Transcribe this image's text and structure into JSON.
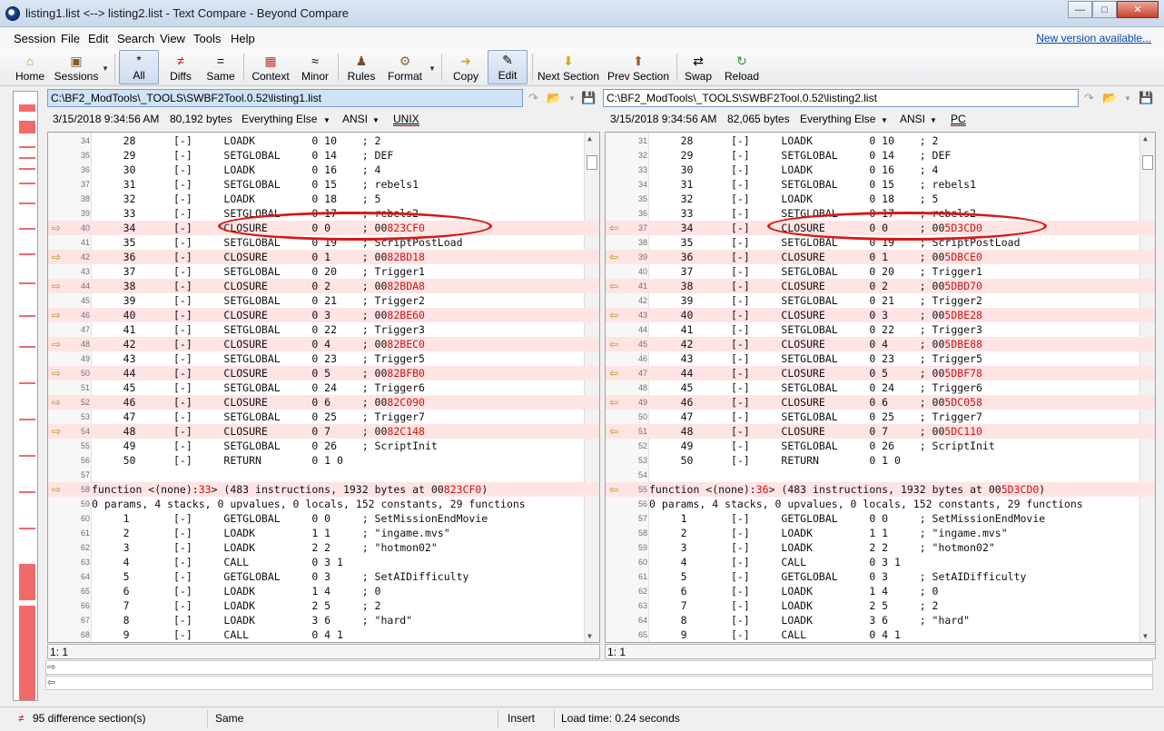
{
  "window": {
    "title": "listing1.list <--> listing2.list - Text Compare - Beyond Compare",
    "min_glyph": "—",
    "max_glyph": "□",
    "close_glyph": "✕"
  },
  "menu": {
    "items": [
      "Session",
      "File",
      "Edit",
      "Search",
      "View",
      "Tools",
      "Help"
    ],
    "new_version": "New version available..."
  },
  "toolbar": {
    "home": "Home",
    "sessions": "Sessions",
    "all": "All",
    "diffs": "Diffs",
    "same": "Same",
    "context": "Context",
    "minor": "Minor",
    "rules": "Rules",
    "format": "Format",
    "copy": "Copy",
    "edit": "Edit",
    "next_section": "Next Section",
    "prev_section": "Prev Section",
    "swap": "Swap",
    "reload": "Reload"
  },
  "left": {
    "path": "C:\\BF2_ModTools\\_TOOLS\\SWBF2Tool.0.52\\listing1.list",
    "date": "3/15/2018 9:34:56 AM",
    "size": "80,192 bytes",
    "filter": "Everything Else",
    "encoding": "ANSI",
    "line_ending": "UNIX",
    "position": "1: 1"
  },
  "right": {
    "path": "C:\\BF2_ModTools\\_TOOLS\\SWBF2Tool.0.52\\listing2.list",
    "date": "3/15/2018 9:34:56 AM",
    "size": "82,065 bytes",
    "filter": "Everything Else",
    "encoding": "ANSI",
    "line_ending": "PC",
    "position": "1: 1"
  },
  "status": {
    "diff_sections": "95 difference section(s)",
    "same": "Same",
    "insert": "Insert",
    "load_time": "Load time: 0.24 seconds"
  },
  "colors": {
    "diff_bg": "#ffe4e4",
    "hl_text": "#d01010",
    "annotation": "#d81818",
    "arrow": "#b8900e"
  },
  "left_lines": [
    {
      "n": "34",
      "d": false,
      "t": "     28      [-]     LOADK         0 10    ; 2"
    },
    {
      "n": "35",
      "d": false,
      "t": "     29      [-]     SETGLOBAL     0 14    ; DEF"
    },
    {
      "n": "36",
      "d": false,
      "t": "     30      [-]     LOADK         0 16    ; 4"
    },
    {
      "n": "37",
      "d": false,
      "t": "     31      [-]     SETGLOBAL     0 15    ; rebels1"
    },
    {
      "n": "38",
      "d": false,
      "t": "     32      [-]     LOADK         0 18    ; 5"
    },
    {
      "n": "39",
      "d": false,
      "t": "     33      [-]     SETGLOBAL     0 17    ; rebels2"
    },
    {
      "n": "40",
      "d": true,
      "t": "     34      [-]     CLOSURE       0 0     ; 00",
      "h": "823C",
      "e": "F0"
    },
    {
      "n": "41",
      "d": false,
      "t": "     35      [-]     SETGLOBAL     0 19    ; ScriptPostLoad"
    },
    {
      "n": "42",
      "d": true,
      "t": "     36      [-]     CLOSURE       0 1     ; 00",
      "h": "82BD18",
      "e": ""
    },
    {
      "n": "43",
      "d": false,
      "t": "     37      [-]     SETGLOBAL     0 20    ; Trigger1"
    },
    {
      "n": "44",
      "d": true,
      "t": "     38      [-]     CLOSURE       0 2     ; 00",
      "h": "82BDA8",
      "e": ""
    },
    {
      "n": "45",
      "d": false,
      "t": "     39      [-]     SETGLOBAL     0 21    ; Trigger2"
    },
    {
      "n": "46",
      "d": true,
      "t": "     40      [-]     CLOSURE       0 3     ; 00",
      "h": "82BE60",
      "e": ""
    },
    {
      "n": "47",
      "d": false,
      "t": "     41      [-]     SETGLOBAL     0 22    ; Trigger3"
    },
    {
      "n": "48",
      "d": true,
      "t": "     42      [-]     CLOSURE       0 4     ; 00",
      "h": "82BEC0",
      "e": ""
    },
    {
      "n": "49",
      "d": false,
      "t": "     43      [-]     SETGLOBAL     0 23    ; Trigger5"
    },
    {
      "n": "50",
      "d": true,
      "t": "     44      [-]     CLOSURE       0 5     ; 00",
      "h": "82BFB0",
      "e": ""
    },
    {
      "n": "51",
      "d": false,
      "t": "     45      [-]     SETGLOBAL     0 24    ; Trigger6"
    },
    {
      "n": "52",
      "d": true,
      "t": "     46      [-]     CLOSURE       0 6     ; 00",
      "h": "82C090",
      "e": ""
    },
    {
      "n": "53",
      "d": false,
      "t": "     47      [-]     SETGLOBAL     0 25    ; Trigger7"
    },
    {
      "n": "54",
      "d": true,
      "t": "     48      [-]     CLOSURE       0 7     ; 00",
      "h": "82C148",
      "e": ""
    },
    {
      "n": "55",
      "d": false,
      "t": "     49      [-]     SETGLOBAL     0 26    ; ScriptInit"
    },
    {
      "n": "56",
      "d": false,
      "t": "     50      [-]     RETURN        0 1 0"
    },
    {
      "n": "57",
      "d": false,
      "t": ""
    },
    {
      "n": "58",
      "d": true,
      "t": "function <(none):",
      "h": "33",
      "e": "> (483 instructions, 1932 bytes at 00",
      "h2": "823C",
      "e2": "F0)",
      "mode": "fn"
    },
    {
      "n": "59",
      "d": false,
      "t": "0 params, 4 stacks, 0 upvalues, 0 locals, 152 constants, 29 functions",
      "raw": true
    },
    {
      "n": "60",
      "d": false,
      "t": "     1       [-]     GETGLOBAL     0 0     ; SetMissionEndMovie"
    },
    {
      "n": "61",
      "d": false,
      "t": "     2       [-]     LOADK         1 1     ; \"ingame.mvs\""
    },
    {
      "n": "62",
      "d": false,
      "t": "     3       [-]     LOADK         2 2     ; \"hotmon02\""
    },
    {
      "n": "63",
      "d": false,
      "t": "     4       [-]     CALL          0 3 1"
    },
    {
      "n": "64",
      "d": false,
      "t": "     5       [-]     GETGLOBAL     0 3     ; SetAIDifficulty"
    },
    {
      "n": "65",
      "d": false,
      "t": "     6       [-]     LOADK         1 4     ; 0"
    },
    {
      "n": "66",
      "d": false,
      "t": "     7       [-]     LOADK         2 5     ; 2"
    },
    {
      "n": "67",
      "d": false,
      "t": "     8       [-]     LOADK         3 6     ; \"hard\""
    },
    {
      "n": "68",
      "d": false,
      "t": "     9       [-]     CALL          0 4 1"
    }
  ],
  "right_lines": [
    {
      "n": "31",
      "d": false,
      "t": "     28      [-]     LOADK         0 10    ; 2"
    },
    {
      "n": "32",
      "d": false,
      "t": "     29      [-]     SETGLOBAL     0 14    ; DEF"
    },
    {
      "n": "33",
      "d": false,
      "t": "     30      [-]     LOADK         0 16    ; 4"
    },
    {
      "n": "34",
      "d": false,
      "t": "     31      [-]     SETGLOBAL     0 15    ; rebels1"
    },
    {
      "n": "35",
      "d": false,
      "t": "     32      [-]     LOADK         0 18    ; 5"
    },
    {
      "n": "36",
      "d": false,
      "t": "     33      [-]     SETGLOBAL     0 17    ; rebels2"
    },
    {
      "n": "37",
      "d": true,
      "t": "     34      [-]     CLOSURE       0 0     ; 00",
      "h": "5D3CD0",
      "e": ""
    },
    {
      "n": "38",
      "d": false,
      "t": "     35      [-]     SETGLOBAL     0 19    ; ScriptPostLoad"
    },
    {
      "n": "39",
      "d": true,
      "t": "     36      [-]     CLOSURE       0 1     ; 00",
      "h": "5DBCE0",
      "e": ""
    },
    {
      "n": "40",
      "d": false,
      "t": "     37      [-]     SETGLOBAL     0 20    ; Trigger1"
    },
    {
      "n": "41",
      "d": true,
      "t": "     38      [-]     CLOSURE       0 2     ; 00",
      "h": "5DBD70",
      "e": ""
    },
    {
      "n": "42",
      "d": false,
      "t": "     39      [-]     SETGLOBAL     0 21    ; Trigger2"
    },
    {
      "n": "43",
      "d": true,
      "t": "     40      [-]     CLOSURE       0 3     ; 00",
      "h": "5DBE28",
      "e": ""
    },
    {
      "n": "44",
      "d": false,
      "t": "     41      [-]     SETGLOBAL     0 22    ; Trigger3"
    },
    {
      "n": "45",
      "d": true,
      "t": "     42      [-]     CLOSURE       0 4     ; 00",
      "h": "5DBE88",
      "e": ""
    },
    {
      "n": "46",
      "d": false,
      "t": "     43      [-]     SETGLOBAL     0 23    ; Trigger5"
    },
    {
      "n": "47",
      "d": true,
      "t": "     44      [-]     CLOSURE       0 5     ; 00",
      "h": "5DBF78",
      "e": ""
    },
    {
      "n": "48",
      "d": false,
      "t": "     45      [-]     SETGLOBAL     0 24    ; Trigger6"
    },
    {
      "n": "49",
      "d": true,
      "t": "     46      [-]     CLOSURE       0 6     ; 00",
      "h": "5DC058",
      "e": ""
    },
    {
      "n": "50",
      "d": false,
      "t": "     47      [-]     SETGLOBAL     0 25    ; Trigger7"
    },
    {
      "n": "51",
      "d": true,
      "t": "     48      [-]     CLOSURE       0 7     ; 00",
      "h": "5DC110",
      "e": ""
    },
    {
      "n": "52",
      "d": false,
      "t": "     49      [-]     SETGLOBAL     0 26    ; ScriptInit"
    },
    {
      "n": "53",
      "d": false,
      "t": "     50      [-]     RETURN        0 1 0"
    },
    {
      "n": "54",
      "d": false,
      "t": ""
    },
    {
      "n": "55",
      "d": true,
      "t": "function <(none):",
      "h": "36",
      "e": "> (483 instructions, 1932 bytes at 00",
      "h2": "5D3CD0",
      "e2": ")",
      "mode": "fn"
    },
    {
      "n": "56",
      "d": false,
      "t": "0 params, 4 stacks, 0 upvalues, 0 locals, 152 constants, 29 functions",
      "raw": true
    },
    {
      "n": "57",
      "d": false,
      "t": "     1       [-]     GETGLOBAL     0 0     ; SetMissionEndMovie"
    },
    {
      "n": "58",
      "d": false,
      "t": "     2       [-]     LOADK         1 1     ; \"ingame.mvs\""
    },
    {
      "n": "59",
      "d": false,
      "t": "     3       [-]     LOADK         2 2     ; \"hotmon02\""
    },
    {
      "n": "60",
      "d": false,
      "t": "     4       [-]     CALL          0 3 1"
    },
    {
      "n": "61",
      "d": false,
      "t": "     5       [-]     GETGLOBAL     0 3     ; SetAIDifficulty"
    },
    {
      "n": "62",
      "d": false,
      "t": "     6       [-]     LOADK         1 4     ; 0"
    },
    {
      "n": "63",
      "d": false,
      "t": "     7       [-]     LOADK         2 5     ; 2"
    },
    {
      "n": "64",
      "d": false,
      "t": "     8       [-]     LOADK         3 6     ; \"hard\""
    },
    {
      "n": "65",
      "d": false,
      "t": "     9       [-]     CALL          0 4 1"
    }
  ]
}
